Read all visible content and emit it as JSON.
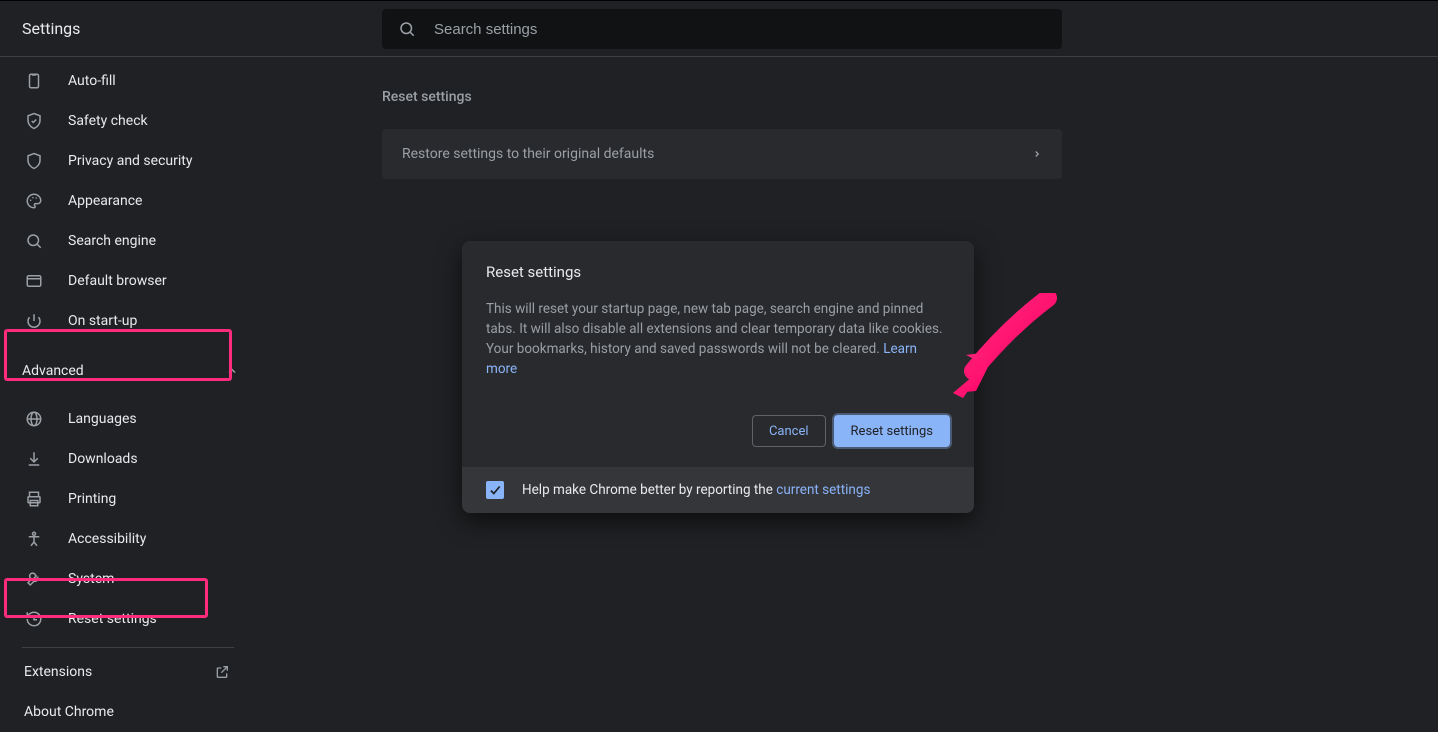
{
  "header": {
    "title": "Settings",
    "search_placeholder": "Search settings"
  },
  "sidebar": {
    "items_top": [
      {
        "icon": "autofill-icon",
        "label": "Auto-fill"
      },
      {
        "icon": "shield-check-icon",
        "label": "Safety check"
      },
      {
        "icon": "shield-icon",
        "label": "Privacy and security"
      },
      {
        "icon": "palette-icon",
        "label": "Appearance"
      },
      {
        "icon": "search-icon",
        "label": "Search engine"
      },
      {
        "icon": "browser-icon",
        "label": "Default browser"
      },
      {
        "icon": "power-icon",
        "label": "On start-up"
      }
    ],
    "advanced_label": "Advanced",
    "items_advanced": [
      {
        "icon": "globe-icon",
        "label": "Languages"
      },
      {
        "icon": "download-icon",
        "label": "Downloads"
      },
      {
        "icon": "print-icon",
        "label": "Printing"
      },
      {
        "icon": "accessibility-icon",
        "label": "Accessibility"
      },
      {
        "icon": "wrench-icon",
        "label": "System"
      },
      {
        "icon": "restore-icon",
        "label": "Reset settings"
      }
    ],
    "extensions_label": "Extensions",
    "about_label": "About Chrome"
  },
  "main": {
    "section_title": "Reset settings",
    "restore_row_label": "Restore settings to their original defaults"
  },
  "dialog": {
    "title": "Reset settings",
    "body_text": "This will reset your startup page, new tab page, search engine and pinned tabs. It will also disable all extensions and clear temporary data like cookies. Your bookmarks, history and saved passwords will not be cleared. ",
    "learn_more": "Learn more",
    "cancel": "Cancel",
    "confirm": "Reset settings",
    "help_prefix": "Help make Chrome better by reporting the ",
    "help_link": "current settings",
    "checkbox_checked": true
  },
  "annotations": {
    "arrow_color": "#ff2b7d",
    "highlight_color": "#ff2b7d"
  }
}
